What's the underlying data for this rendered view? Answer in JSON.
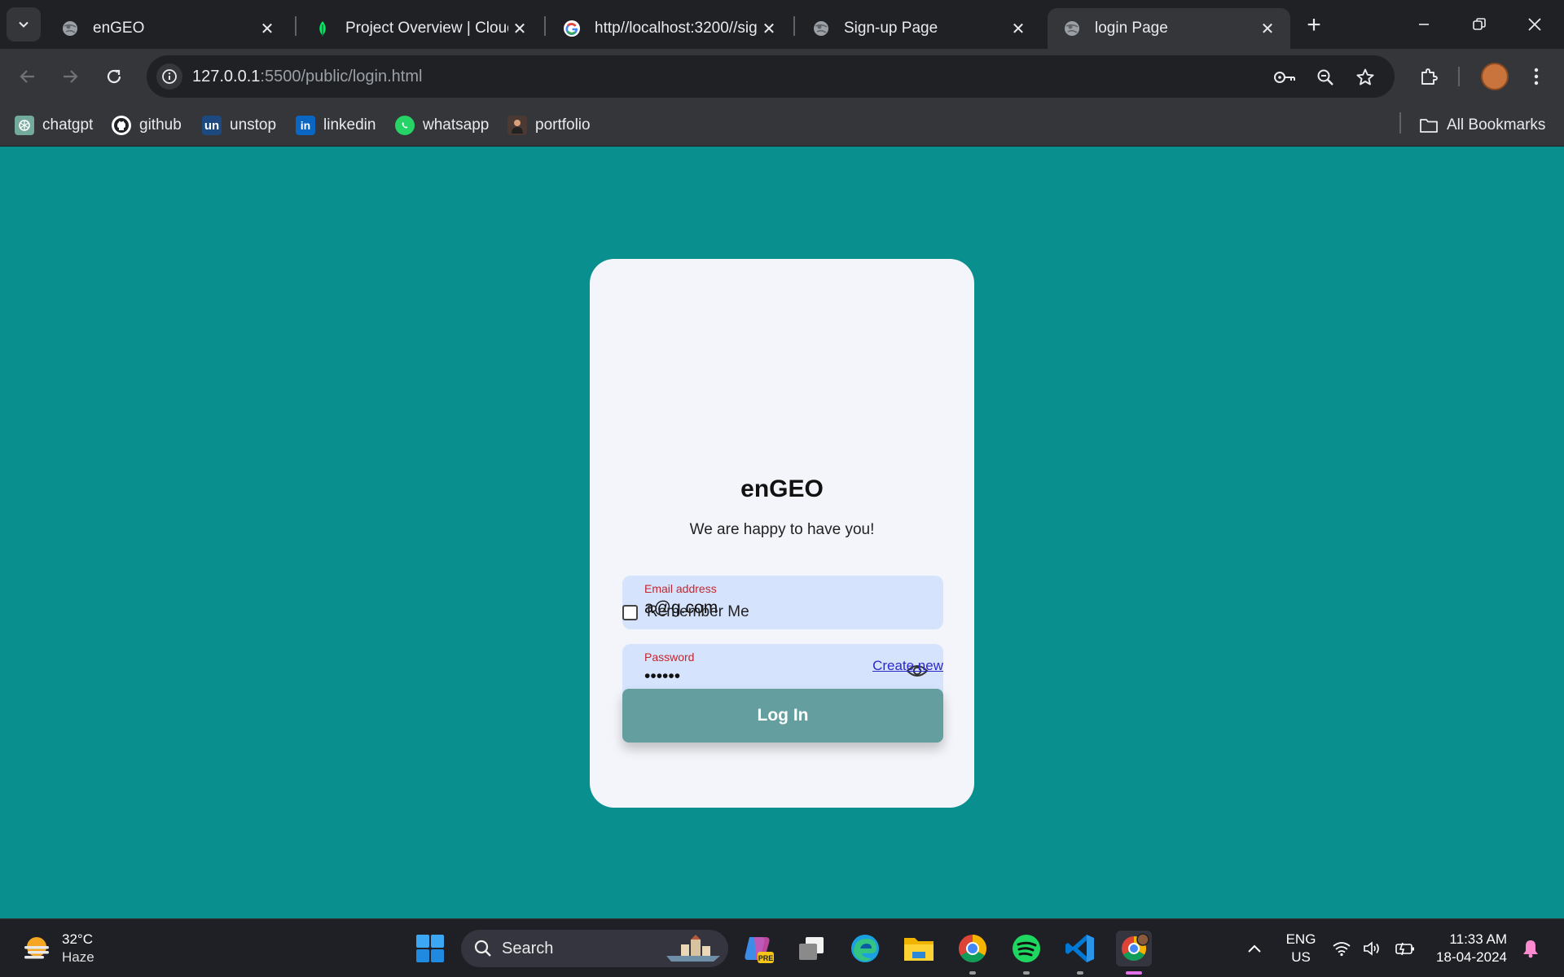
{
  "browser": {
    "tabs": [
      {
        "title": "enGEO",
        "icon": "globe-icon",
        "active": false
      },
      {
        "title": "Project Overview | Cloud",
        "icon": "mongodb-leaf-icon",
        "active": false
      },
      {
        "title": "http//localhost:3200//sig",
        "icon": "google-icon",
        "active": false
      },
      {
        "title": "Sign-up Page",
        "icon": "globe-icon",
        "active": false
      },
      {
        "title": "login Page",
        "icon": "globe-icon",
        "active": true
      }
    ],
    "address": {
      "host": "127.0.0.1",
      "rest": ":5500/public/login.html"
    },
    "bookmarks": [
      {
        "label": "chatgpt",
        "icon": "chatgpt-icon"
      },
      {
        "label": "github",
        "icon": "github-icon"
      },
      {
        "label": "unstop",
        "icon": "unstop-icon",
        "badge": "un"
      },
      {
        "label": "linkedin",
        "icon": "linkedin-icon",
        "badge": "in"
      },
      {
        "label": "whatsapp",
        "icon": "whatsapp-icon"
      },
      {
        "label": "portfolio",
        "icon": "portfolio-icon"
      }
    ],
    "all_bookmarks": "All Bookmarks"
  },
  "login": {
    "brand": "enGEO",
    "tagline": "We are happy to have you!",
    "email_label": "Email address",
    "email_value": "a@g.com",
    "password_label": "Password",
    "password_value": "••••••",
    "remember_label": "Remember Me",
    "create_link": "Create new",
    "login_button": "Log In"
  },
  "taskbar": {
    "weather_temp": "32°C",
    "weather_cond": "Haze",
    "search_label": "Search",
    "lang_line1": "ENG",
    "lang_line2": "US",
    "time": "11:33 AM",
    "date": "18-04-2024"
  },
  "colors": {
    "page_bg": "#0a8f8f",
    "card_bg": "#f4f5fa",
    "input_bg": "#d6e3fd",
    "label_red": "#c4262e",
    "button_bg": "#649e9e",
    "link_blue": "#2b29c9"
  }
}
